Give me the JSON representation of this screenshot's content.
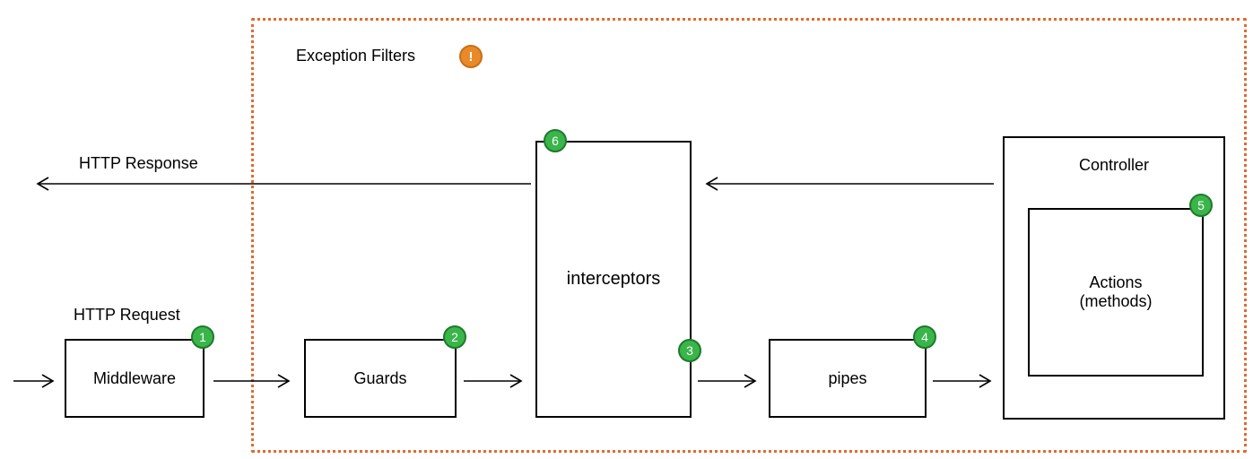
{
  "diagram": {
    "labels": {
      "exceptionFilters": "Exception Filters",
      "httpResponse": "HTTP Response",
      "httpRequest": "HTTP Request",
      "controller": "Controller"
    },
    "boxes": {
      "middleware": "Middleware",
      "guards": "Guards",
      "interceptors": "interceptors",
      "pipes": "pipes",
      "actions": "Actions\n(methods)"
    },
    "badges": {
      "b1": "1",
      "b2": "2",
      "b3": "3",
      "b4": "4",
      "b5": "5",
      "b6": "6",
      "warn": "!"
    },
    "flow_order": [
      "HTTP Request",
      "Middleware",
      "Guards",
      "Interceptors (pre)",
      "Pipes",
      "Controller Actions (methods)",
      "Interceptors (post)",
      "HTTP Response"
    ],
    "exception_filters_scope": [
      "Guards",
      "Interceptors",
      "Pipes",
      "Controller"
    ]
  }
}
